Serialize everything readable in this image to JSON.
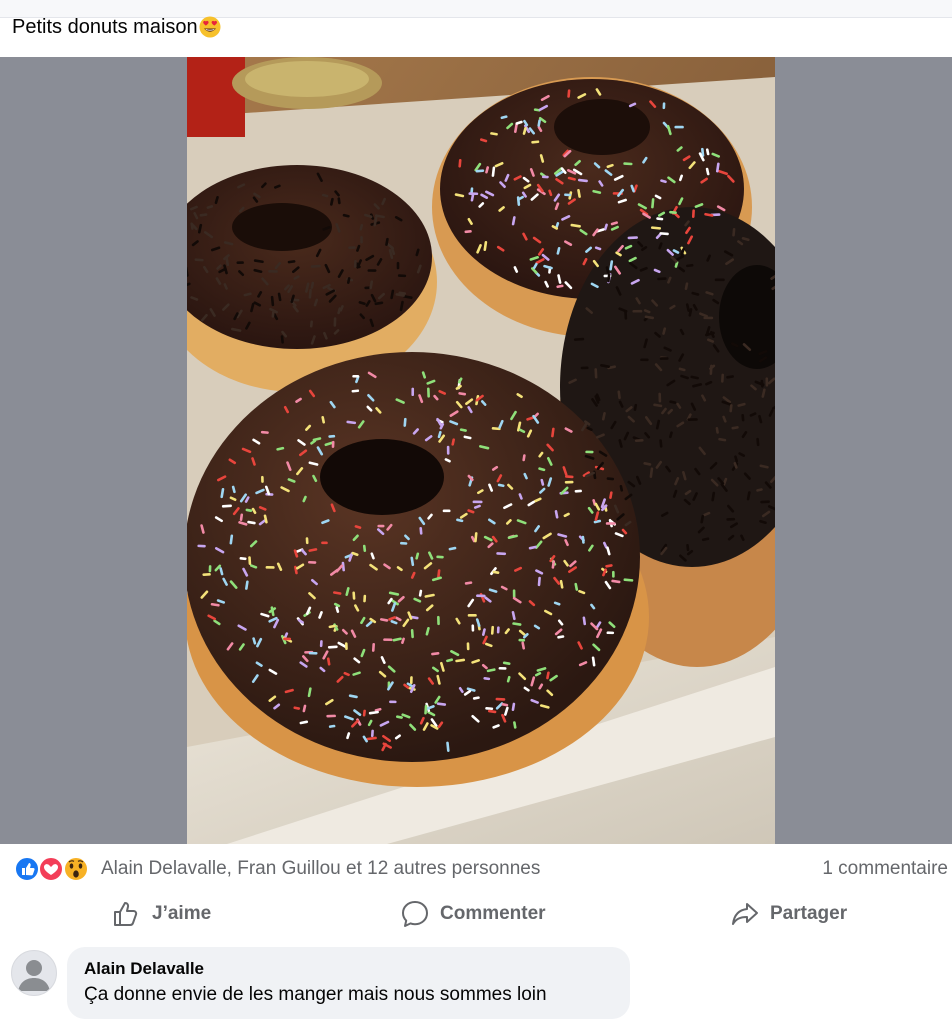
{
  "post": {
    "caption": "Petits donuts maison",
    "caption_emoji": "heart-eyes-emoji",
    "photo_alt": "Photo"
  },
  "reactions": {
    "icons": [
      "like-reaction-icon",
      "love-reaction-icon",
      "wow-reaction-icon"
    ],
    "names": "Alain Delavalle, Fran Guillou et 12 autres personnes",
    "comment_count": "1 commentaire"
  },
  "actions": {
    "like_label": "J’aime",
    "comment_label": "Commenter",
    "share_label": "Partager"
  },
  "comment": {
    "author": "Alain Delavalle",
    "text": "Ça donne envie de les manger mais nous sommes loin"
  },
  "colors": {
    "like_blue": "#1877f2",
    "love_red": "#f33e58",
    "wow_yellow": "#f7b125",
    "muted_text": "#65676b",
    "bubble_bg": "#f0f2f5",
    "photo_backdrop": "#8a8d96"
  }
}
